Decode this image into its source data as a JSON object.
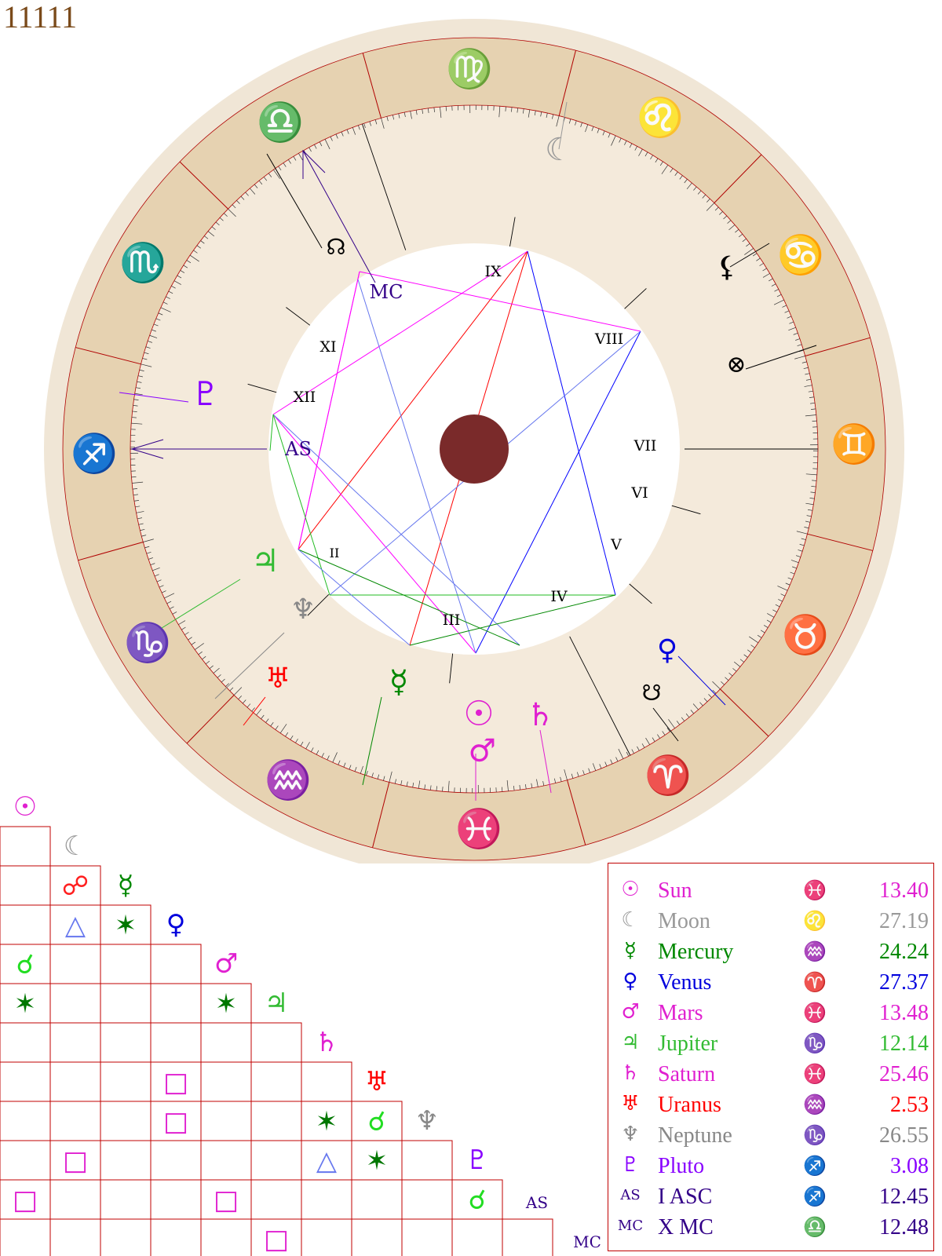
{
  "title": "11111",
  "colors": {
    "outer_ring": "#f0e6d6",
    "zodiac_band": "#e6d2b1",
    "house_band": "#f4eadb",
    "inner_disc": "#ffffff",
    "center": "#7a2a2a",
    "grid_line": "#c00000"
  },
  "zodiac": [
    {
      "name": "pisces-icon",
      "glyph": "♓",
      "color": "#e020d0"
    },
    {
      "name": "aries-icon",
      "glyph": "♈",
      "color": "#ff0000"
    },
    {
      "name": "taurus-icon",
      "glyph": "♉",
      "color": "#22dd22"
    },
    {
      "name": "gemini-icon",
      "glyph": "♊",
      "color": "#ff2ac0"
    },
    {
      "name": "cancer-icon",
      "glyph": "♋",
      "color": "#ff0000"
    },
    {
      "name": "leo-icon",
      "glyph": "♌",
      "color": "#22dd22"
    },
    {
      "name": "virgo-icon",
      "glyph": "♍",
      "color": "#ff2ac0"
    },
    {
      "name": "libra-icon",
      "glyph": "♎",
      "color": "#ff0000"
    },
    {
      "name": "scorpio-icon",
      "glyph": "♏",
      "color": "#22dd22"
    },
    {
      "name": "sagittarius-icon",
      "glyph": "♐",
      "color": "#ff2ac0"
    },
    {
      "name": "capricorn-icon",
      "glyph": "♑",
      "color": "#ff0000"
    },
    {
      "name": "aquarius-icon",
      "glyph": "♒",
      "color": "#22dd22"
    }
  ],
  "houses": [
    "AS",
    "II",
    "III",
    "IV",
    "V",
    "VI",
    "VII",
    "VIII",
    "IX",
    "MC",
    "XI",
    "XII"
  ],
  "chart_planets": [
    {
      "name": "sun-glyph",
      "glyph": "☉",
      "color": "#e020d0"
    },
    {
      "name": "moon-glyph",
      "glyph": "☾",
      "color": "#999999"
    },
    {
      "name": "mercury-glyph",
      "glyph": "☿",
      "color": "#008800"
    },
    {
      "name": "venus-glyph",
      "glyph": "♀",
      "color": "#0000dd"
    },
    {
      "name": "mars-glyph",
      "glyph": "♂",
      "color": "#e020d0"
    },
    {
      "name": "jupiter-glyph",
      "glyph": "♃",
      "color": "#33bb33"
    },
    {
      "name": "saturn-glyph",
      "glyph": "♄",
      "color": "#e020d0"
    },
    {
      "name": "uranus-glyph",
      "glyph": "♅",
      "color": "#ff0000"
    },
    {
      "name": "neptune-glyph",
      "glyph": "♆",
      "color": "#888888"
    },
    {
      "name": "pluto-glyph",
      "glyph": "♇",
      "color": "#8800ff"
    },
    {
      "name": "north-node-glyph",
      "glyph": "☊",
      "color": "#000000"
    },
    {
      "name": "south-node-glyph",
      "glyph": "☋",
      "color": "#000000"
    },
    {
      "name": "lilith-glyph",
      "glyph": "⚸",
      "color": "#000000"
    },
    {
      "name": "fortune-glyph",
      "glyph": "⊗",
      "color": "#000000"
    }
  ],
  "planets": [
    {
      "symbol": "☉",
      "name": "Sun",
      "sign": "♓",
      "degree": "13.40",
      "color": "#e020d0"
    },
    {
      "symbol": "☾",
      "name": "Moon",
      "sign": "♌",
      "degree": "27.19",
      "color": "#999999"
    },
    {
      "symbol": "☿",
      "name": "Mercury",
      "sign": "♒",
      "degree": "24.24",
      "color": "#008800"
    },
    {
      "symbol": "♀",
      "name": "Venus",
      "sign": "♈",
      "degree": "27.37",
      "color": "#0000dd"
    },
    {
      "symbol": "♂",
      "name": "Mars",
      "sign": "♓",
      "degree": "13.48",
      "color": "#e020d0"
    },
    {
      "symbol": "♃",
      "name": "Jupiter",
      "sign": "♑",
      "degree": "12.14",
      "color": "#33bb33"
    },
    {
      "symbol": "♄",
      "name": "Saturn",
      "sign": "♓",
      "degree": "25.46",
      "color": "#e020d0"
    },
    {
      "symbol": "♅",
      "name": "Uranus",
      "sign": "♒",
      "degree": "2.53",
      "color": "#ff0000"
    },
    {
      "symbol": "♆",
      "name": "Neptune",
      "sign": "♑",
      "degree": "26.55",
      "color": "#888888"
    },
    {
      "symbol": "♇",
      "name": "Pluto",
      "sign": "♐",
      "degree": "3.08",
      "color": "#8800ff"
    },
    {
      "symbol": "AS",
      "name": "I ASC",
      "sign": "♐",
      "degree": "12.45",
      "color": "#330088"
    },
    {
      "symbol": "MC",
      "name": "X MC",
      "sign": "♎",
      "degree": "12.48",
      "color": "#330088"
    }
  ],
  "aspect_grid": {
    "labels": [
      "☉",
      "☾",
      "☿",
      "♀",
      "♂",
      "♃",
      "♄",
      "♅",
      "♆",
      "♇",
      "AS",
      "MC"
    ],
    "label_colors": [
      "#e020d0",
      "#999999",
      "#008800",
      "#0000dd",
      "#e020d0",
      "#33bb33",
      "#e020d0",
      "#ff0000",
      "#888888",
      "#8800ff",
      "#330088",
      "#330088"
    ],
    "aspects": [
      {
        "row": 2,
        "col": 1,
        "glyph": "☍",
        "color": "#ff2020"
      },
      {
        "row": 3,
        "col": 1,
        "glyph": "△",
        "color": "#6677ee"
      },
      {
        "row": 3,
        "col": 2,
        "glyph": "✶",
        "color": "#007700"
      },
      {
        "row": 4,
        "col": 0,
        "glyph": "☌",
        "color": "#22dd22"
      },
      {
        "row": 5,
        "col": 0,
        "glyph": "✶",
        "color": "#007700"
      },
      {
        "row": 5,
        "col": 4,
        "glyph": "✶",
        "color": "#007700"
      },
      {
        "row": 7,
        "col": 3,
        "glyph": "□",
        "color": "#e020d0"
      },
      {
        "row": 8,
        "col": 3,
        "glyph": "□",
        "color": "#e020d0"
      },
      {
        "row": 8,
        "col": 6,
        "glyph": "✶",
        "color": "#007700"
      },
      {
        "row": 8,
        "col": 7,
        "glyph": "☌",
        "color": "#22dd22"
      },
      {
        "row": 9,
        "col": 1,
        "glyph": "□",
        "color": "#e020d0"
      },
      {
        "row": 9,
        "col": 6,
        "glyph": "△",
        "color": "#6677ee"
      },
      {
        "row": 9,
        "col": 7,
        "glyph": "✶",
        "color": "#007700"
      },
      {
        "row": 10,
        "col": 0,
        "glyph": "□",
        "color": "#e020d0"
      },
      {
        "row": 10,
        "col": 4,
        "glyph": "□",
        "color": "#e020d0"
      },
      {
        "row": 10,
        "col": 9,
        "glyph": "☌",
        "color": "#22dd22"
      },
      {
        "row": 11,
        "col": 5,
        "glyph": "□",
        "color": "#e020d0"
      }
    ]
  }
}
